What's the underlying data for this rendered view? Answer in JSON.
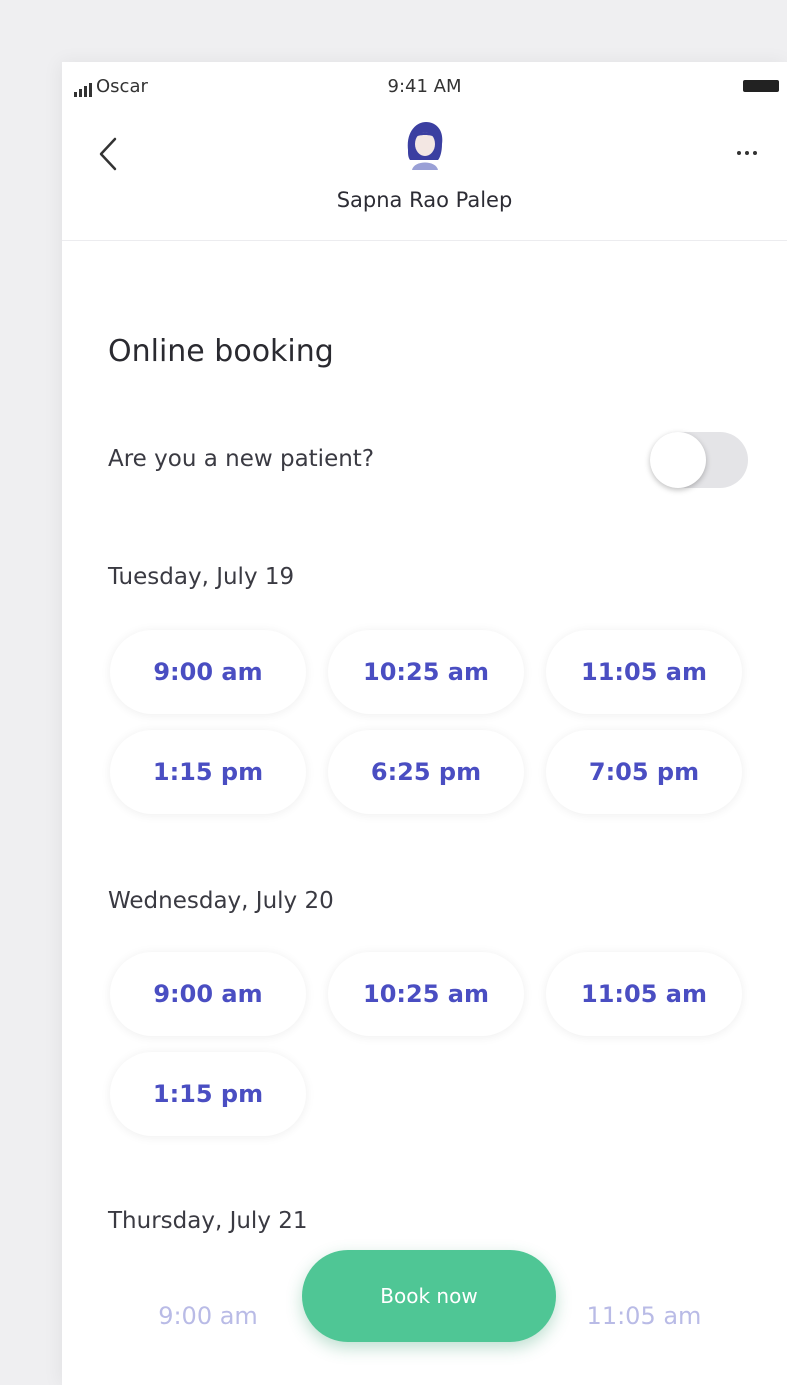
{
  "status_bar": {
    "carrier": "Oscar",
    "time": "9:41 AM"
  },
  "header": {
    "doctor_name": "Sapna Rao Palep"
  },
  "booking": {
    "title": "Online booking",
    "new_patient_question": "Are you a new patient?",
    "new_patient_toggle_on": false
  },
  "days": [
    {
      "label": "Tuesday, July 19",
      "slots": [
        "9:00 am",
        "10:25 am",
        "11:05 am",
        "1:15 pm",
        "6:25 pm",
        "7:05 pm"
      ]
    },
    {
      "label": "Wednesday, July 20",
      "slots": [
        "9:00 am",
        "10:25 am",
        "11:05 am",
        "1:15 pm"
      ]
    },
    {
      "label": "Thursday, July 21",
      "slots": [
        "9:00 am",
        "11:05 am"
      ]
    }
  ],
  "book_button_label": "Book now",
  "colors": {
    "accent_blue": "#4a4ec2",
    "book_green": "#4fc695"
  }
}
